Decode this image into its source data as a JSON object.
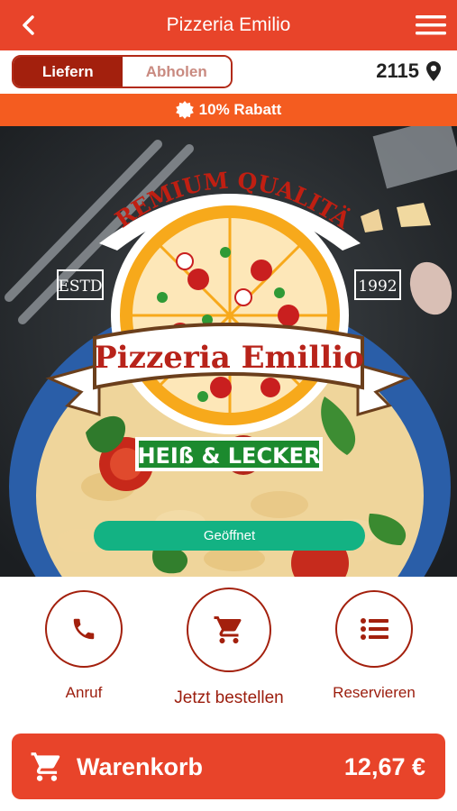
{
  "header": {
    "title": "Pizzeria Emilio",
    "back_icon": "chevron-left-icon",
    "menu_icon": "hamburger-menu-icon"
  },
  "delivery": {
    "options": [
      "Liefern",
      "Abholen"
    ],
    "selected": "Liefern",
    "postcode": "2115",
    "location_icon": "map-pin-icon"
  },
  "discount": {
    "label": "10% Rabatt",
    "icon": "badge-icon"
  },
  "hero": {
    "top_arc": "PREMIUM QUALITÄT",
    "estd": "ESTD",
    "year": "1992",
    "brand": "Pizzeria Emillio",
    "slogan": "HEIß & LECKER"
  },
  "status_button": "Geöffnet",
  "actions": [
    {
      "label": "Anruf",
      "icon": "phone-icon"
    },
    {
      "label": "Jetzt bestellen",
      "icon": "shopping-cart-icon"
    },
    {
      "label": "Reservieren",
      "icon": "list-icon"
    }
  ],
  "cart": {
    "label": "Warenkorb",
    "price": "12,67 €",
    "icon": "shopping-cart-icon"
  },
  "colors": {
    "primary": "#e8442a",
    "dark_red": "#a3200d",
    "discount": "#f45c20",
    "open_green": "#13b283"
  }
}
